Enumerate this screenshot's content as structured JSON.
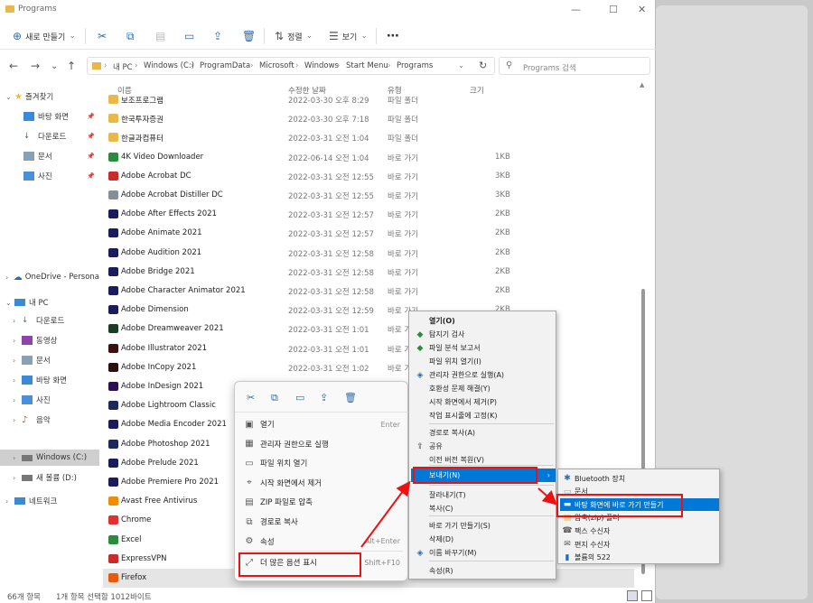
{
  "window": {
    "title": "Programs"
  },
  "cmdbar": {
    "new_label": "새로 만들기",
    "sort_label": "정렬",
    "view_label": "보기"
  },
  "address": {
    "crumbs": [
      "내 PC",
      "Windows (C:)",
      "ProgramData",
      "Microsoft",
      "Windows",
      "Start Menu",
      "Programs"
    ],
    "search_placeholder": "Programs 검색"
  },
  "sidebar": {
    "quick_access": "즐겨찾기",
    "pinned": [
      "바탕 화면",
      "다운로드",
      "문서",
      "사진"
    ],
    "onedrive": "OneDrive - Persona",
    "this_pc": "내 PC",
    "pc_items": [
      "다운로드",
      "동영상",
      "문서",
      "바탕 화면",
      "사진",
      "음악"
    ],
    "drive_c": "Windows (C:)",
    "drive_d": "새 볼륨 (D:)",
    "network": "네트워크"
  },
  "columns": {
    "name": "이름",
    "date": "수정한 날짜",
    "type": "유형",
    "size": "크기"
  },
  "files": [
    {
      "name": "보조프로그램",
      "date": "2022-03-30 오후 8:29",
      "type": "파일 폴더",
      "size": ""
    },
    {
      "name": "한국투자증권",
      "date": "2022-03-30 오후 7:18",
      "type": "파일 폴더",
      "size": ""
    },
    {
      "name": "한글과컴퓨터",
      "date": "2022-03-31 오전 1:04",
      "type": "파일 폴더",
      "size": ""
    },
    {
      "name": "4K Video Downloader",
      "date": "2022-06-14 오전 1:04",
      "type": "바로 가기",
      "size": "1KB"
    },
    {
      "name": "Adobe Acrobat DC",
      "date": "2022-03-31 오전 12:55",
      "type": "바로 가기",
      "size": "3KB"
    },
    {
      "name": "Adobe Acrobat Distiller DC",
      "date": "2022-03-31 오전 12:55",
      "type": "바로 가기",
      "size": "3KB"
    },
    {
      "name": "Adobe After Effects 2021",
      "date": "2022-03-31 오전 12:57",
      "type": "바로 가기",
      "size": "2KB"
    },
    {
      "name": "Adobe Animate 2021",
      "date": "2022-03-31 오전 12:57",
      "type": "바로 가기",
      "size": "2KB"
    },
    {
      "name": "Adobe Audition 2021",
      "date": "2022-03-31 오전 12:58",
      "type": "바로 가기",
      "size": "2KB"
    },
    {
      "name": "Adobe Bridge 2021",
      "date": "2022-03-31 오전 12:58",
      "type": "바로 가기",
      "size": "2KB"
    },
    {
      "name": "Adobe Character Animator 2021",
      "date": "2022-03-31 오전 12:58",
      "type": "바로 가기",
      "size": "2KB"
    },
    {
      "name": "Adobe Dimension",
      "date": "2022-03-31 오전 12:59",
      "type": "바로 가기",
      "size": "2KB"
    },
    {
      "name": "Adobe Dreamweaver 2021",
      "date": "2022-03-31 오전 1:01",
      "type": "바로 가기",
      "size": ""
    },
    {
      "name": "Adobe Illustrator 2021",
      "date": "2022-03-31 오전 1:01",
      "type": "바로 가기",
      "size": ""
    },
    {
      "name": "Adobe InCopy 2021",
      "date": "2022-03-31 오전 1:02",
      "type": "바로 가기",
      "size": ""
    },
    {
      "name": "Adobe InDesign 2021",
      "date": "",
      "type": "",
      "size": ""
    },
    {
      "name": "Adobe Lightroom Classic",
      "date": "",
      "type": "",
      "size": ""
    },
    {
      "name": "Adobe Media Encoder 2021",
      "date": "",
      "type": "",
      "size": ""
    },
    {
      "name": "Adobe Photoshop 2021",
      "date": "",
      "type": "",
      "size": ""
    },
    {
      "name": "Adobe Prelude 2021",
      "date": "",
      "type": "",
      "size": ""
    },
    {
      "name": "Adobe Premiere Pro 2021",
      "date": "",
      "type": "",
      "size": ""
    },
    {
      "name": "Avast Free Antivirus",
      "date": "",
      "type": "",
      "size": ""
    },
    {
      "name": "Chrome",
      "date": "",
      "type": "",
      "size": ""
    },
    {
      "name": "Excel",
      "date": "",
      "type": "",
      "size": ""
    },
    {
      "name": "ExpressVPN",
      "date": "",
      "type": "",
      "size": ""
    },
    {
      "name": "Firefox",
      "date": "",
      "type": "",
      "size": ""
    }
  ],
  "status": {
    "count": "66개 항목",
    "selected": "1개 항목 선택함 1012바이트"
  },
  "context_menu": {
    "items": [
      {
        "icon": "open-icon",
        "label": "열기",
        "shortcut": "Enter"
      },
      {
        "icon": "admin-icon",
        "label": "관리자 권한으로 실행",
        "shortcut": ""
      },
      {
        "icon": "folder-location-icon",
        "label": "파일 위치 열기",
        "shortcut": ""
      },
      {
        "icon": "unpin-icon",
        "label": "시작 화면에서 제거",
        "shortcut": ""
      },
      {
        "icon": "zip-icon",
        "label": "ZIP 파일로 압축",
        "shortcut": ""
      },
      {
        "icon": "copy-path-icon",
        "label": "경로로 복사",
        "shortcut": ""
      },
      {
        "icon": "properties-icon",
        "label": "속성",
        "shortcut": "Alt+Enter"
      },
      {
        "icon": "more-options-icon",
        "label": "더 많은 옵션 표시",
        "shortcut": "Shift+F10"
      }
    ]
  },
  "classic_menu": {
    "items": [
      {
        "label": "열기(O)"
      },
      {
        "label": "탐지기 검사"
      },
      {
        "label": "파일 분석 보고서"
      },
      {
        "label": "파일 위치 열기(I)"
      },
      {
        "label": "관리자 권한으로 실행(A)"
      },
      {
        "label": "호환성 문제 해결(Y)"
      },
      {
        "label": "시작 화면에서 제거(P)"
      },
      {
        "label": "작업 표시줄에 고정(K)"
      },
      {
        "label": "경로로 복사(A)"
      },
      {
        "label": "공유"
      },
      {
        "label": "이전 버전 복원(V)"
      },
      {
        "label": "보내기(N)"
      },
      {
        "label": "잘라내기(T)"
      },
      {
        "label": "복사(C)"
      },
      {
        "label": "바로 가기 만들기(S)"
      },
      {
        "label": "삭제(D)"
      },
      {
        "label": "이름 바꾸기(M)"
      },
      {
        "label": "속성(R)"
      }
    ]
  },
  "sendto_menu": {
    "items": [
      {
        "label": "Bluetooth 장치"
      },
      {
        "label": "문서"
      },
      {
        "label": "바탕 화면에 바로 가기 만들기"
      },
      {
        "label": "압축(zip) 폴더"
      },
      {
        "label": "팩스 수신자"
      },
      {
        "label": "편지 수신자"
      },
      {
        "label": "볼륨의 522"
      }
    ]
  },
  "colors": {
    "accent": "#0078d7",
    "highlight_box": "#ee1111",
    "folder": "#e8b84a"
  }
}
